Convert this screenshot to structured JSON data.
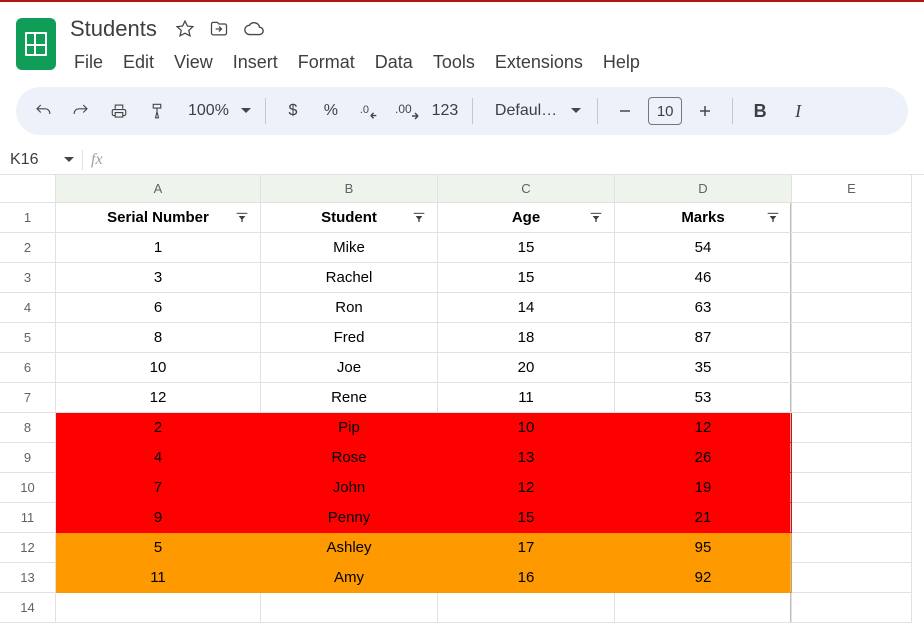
{
  "title": "Students",
  "menus": [
    "File",
    "Edit",
    "View",
    "Insert",
    "Format",
    "Data",
    "Tools",
    "Extensions",
    "Help"
  ],
  "toolbar": {
    "zoom": "100%",
    "font": "Defaul…",
    "font_size": "10",
    "number_fmt": "123"
  },
  "name_box": "K16",
  "fx_label": "fx",
  "columns": [
    "A",
    "B",
    "C",
    "D",
    "E"
  ],
  "headers": [
    "Serial Number",
    "Student",
    "Age",
    "Marks"
  ],
  "rows": [
    {
      "n": "1",
      "type": "header"
    },
    {
      "n": "2",
      "type": "white",
      "cells": [
        "1",
        "Mike",
        "15",
        "54"
      ]
    },
    {
      "n": "3",
      "type": "white",
      "cells": [
        "3",
        "Rachel",
        "15",
        "46"
      ]
    },
    {
      "n": "4",
      "type": "white",
      "cells": [
        "6",
        "Ron",
        "14",
        "63"
      ]
    },
    {
      "n": "5",
      "type": "white",
      "cells": [
        "8",
        "Fred",
        "18",
        "87"
      ]
    },
    {
      "n": "6",
      "type": "white",
      "cells": [
        "10",
        "Joe",
        "20",
        "35"
      ]
    },
    {
      "n": "7",
      "type": "white",
      "cells": [
        "12",
        "Rene",
        "11",
        "53"
      ]
    },
    {
      "n": "8",
      "type": "red",
      "cells": [
        "2",
        "Pip",
        "10",
        "12"
      ]
    },
    {
      "n": "9",
      "type": "red",
      "cells": [
        "4",
        "Rose",
        "13",
        "26"
      ]
    },
    {
      "n": "10",
      "type": "red",
      "cells": [
        "7",
        "John",
        "12",
        "19"
      ]
    },
    {
      "n": "11",
      "type": "red",
      "cells": [
        "9",
        "Penny",
        "15",
        "21"
      ]
    },
    {
      "n": "12",
      "type": "orange",
      "cells": [
        "5",
        "Ashley",
        "17",
        "95"
      ]
    },
    {
      "n": "13",
      "type": "orange",
      "cells": [
        "11",
        "Amy",
        "16",
        "92"
      ]
    },
    {
      "n": "14",
      "type": "empty"
    }
  ],
  "colors": {
    "red": "#ff0000",
    "orange": "#ff9900"
  }
}
